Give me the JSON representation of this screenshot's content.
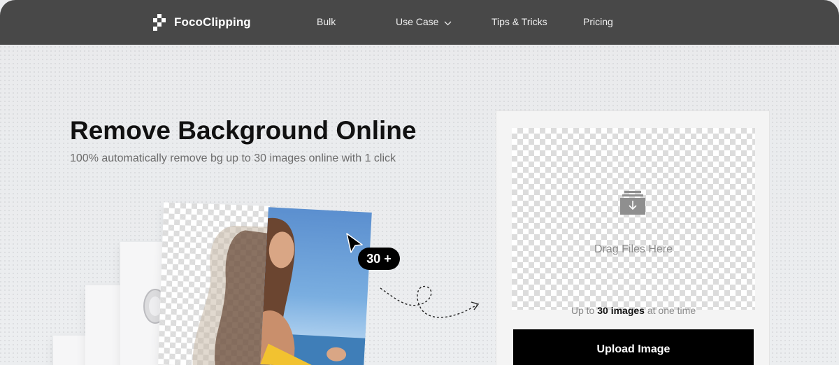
{
  "nav": {
    "brand": "FocoClipping",
    "items": [
      {
        "label": "Bulk"
      },
      {
        "label": "Use Case"
      },
      {
        "label": "Tips & Tricks"
      },
      {
        "label": "Pricing"
      }
    ]
  },
  "hero": {
    "title": "Remove Background Online",
    "subtitle": "100% automatically remove bg up to 30 images online with 1 click"
  },
  "illustration": {
    "badge": "30 +"
  },
  "upload": {
    "drop_text": "Drag Files Here",
    "limit_prefix": "Up to ",
    "limit_bold": "30 images",
    "limit_suffix": " at one time",
    "button_label": "Upload Image"
  },
  "colors": {
    "nav_bg": "#484848",
    "button_bg": "#000000",
    "page_bg": "#ebecee"
  }
}
